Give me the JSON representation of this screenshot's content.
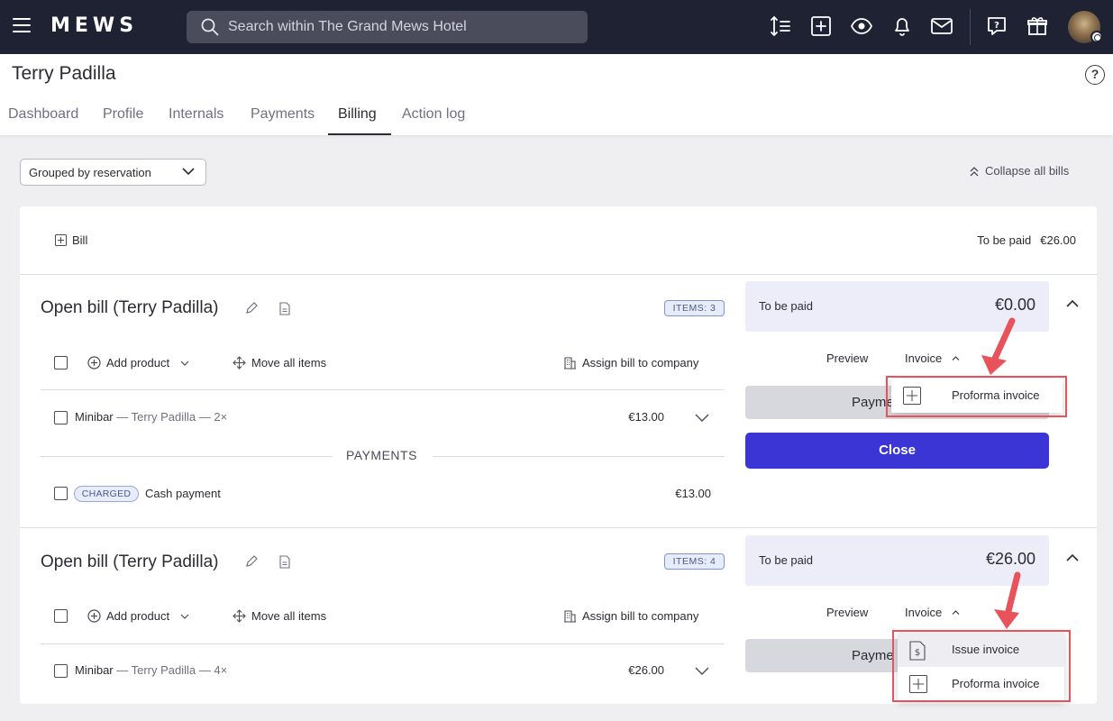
{
  "topbar": {
    "logo": "MEWS",
    "search_placeholder": "Search within The Grand Mews Hotel",
    "icons": [
      "sort-icon",
      "plus-square-icon",
      "eye-icon",
      "bell-icon",
      "mail-icon",
      "feedback-icon",
      "gift-icon"
    ]
  },
  "header": {
    "title": "Terry Padilla",
    "tabs": [
      "Dashboard",
      "Profile",
      "Internals",
      "Payments",
      "Billing",
      "Action log"
    ],
    "active_tab": "Billing"
  },
  "toolbar": {
    "grouping": "Grouped by reservation",
    "collapse_label": "Collapse all bills"
  },
  "summary_top": {
    "add_bill_label": "Bill",
    "to_be_paid_label": "To be paid",
    "to_be_paid_amount": "€26.00"
  },
  "bills": [
    {
      "title": "Open bill (Terry Padilla)",
      "items_badge": "ITEMS: 3",
      "add_product": "Add product",
      "move_all": "Move all items",
      "assign_company": "Assign bill to company",
      "line_item": {
        "product": "Minibar",
        "detail": " — Terry Padilla — 2×",
        "amount": "€13.00"
      },
      "payments_header": "PAYMENTS",
      "payment": {
        "badge": "CHARGED",
        "label": "Cash payment",
        "amount": "€13.00"
      },
      "to_be_paid_label": "To be paid",
      "to_be_paid_amount": "€0.00",
      "preview": "Preview",
      "invoice": "Invoice",
      "payment_button": "Payme",
      "close_button": "Close",
      "menu": [
        "Proforma invoice"
      ]
    },
    {
      "title": "Open bill (Terry Padilla)",
      "items_badge": "ITEMS: 4",
      "add_product": "Add product",
      "move_all": "Move all items",
      "assign_company": "Assign bill to company",
      "line_item": {
        "product": "Minibar",
        "detail": " — Terry Padilla — 4×",
        "amount": "€26.00"
      },
      "to_be_paid_label": "To be paid",
      "to_be_paid_amount": "€26.00",
      "preview": "Preview",
      "invoice": "Invoice",
      "payment_button": "Payme",
      "menu": [
        "Issue invoice",
        "Proforma invoice"
      ]
    }
  ],
  "colors": {
    "topbar": "#1f2233",
    "primary": "#3b35d6",
    "highlight": "#e8525a",
    "summary_bg": "#ecedf9"
  }
}
